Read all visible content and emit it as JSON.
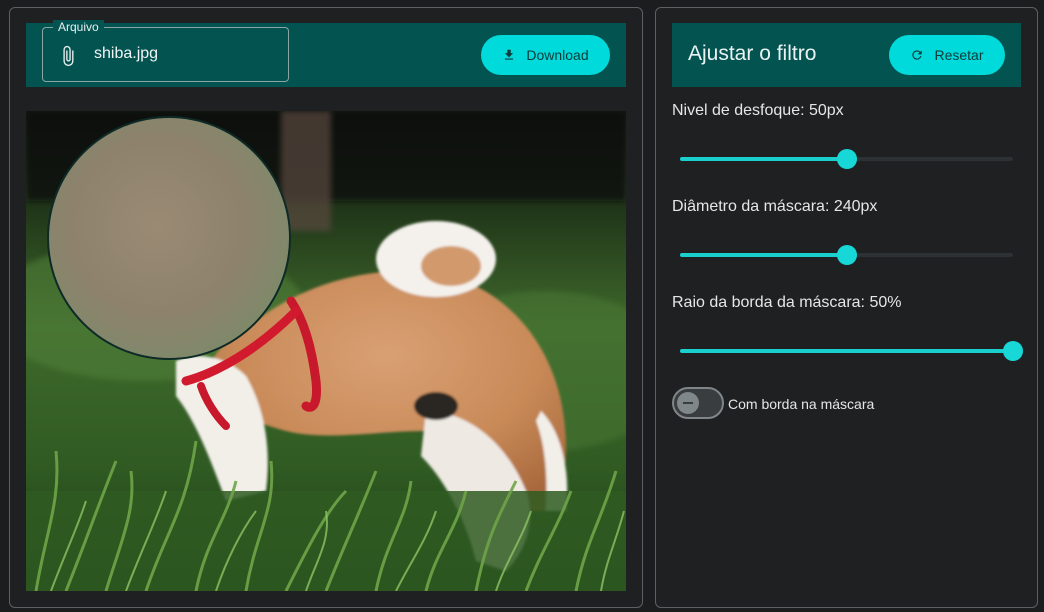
{
  "file": {
    "legend": "Arquivo",
    "name": "shiba.jpg",
    "download_label": "Download"
  },
  "filter": {
    "title": "Ajustar o filtro",
    "reset_label": "Resetar",
    "settings": [
      {
        "label": "Nivel de desfoque: 50px",
        "value": 0.5
      },
      {
        "label": "Diâmetro da máscara: 240px",
        "value": 0.5
      },
      {
        "label": "Raio da borda da máscara: 50%",
        "value": 1.0
      }
    ],
    "toggle_label": "Com borda na máscara",
    "toggle_on": false
  },
  "colors": {
    "accent": "#00dada",
    "bar": "#035350",
    "background": "#1b1d1e"
  },
  "icons": [
    "paperclip-icon",
    "download-icon",
    "refresh-icon"
  ]
}
